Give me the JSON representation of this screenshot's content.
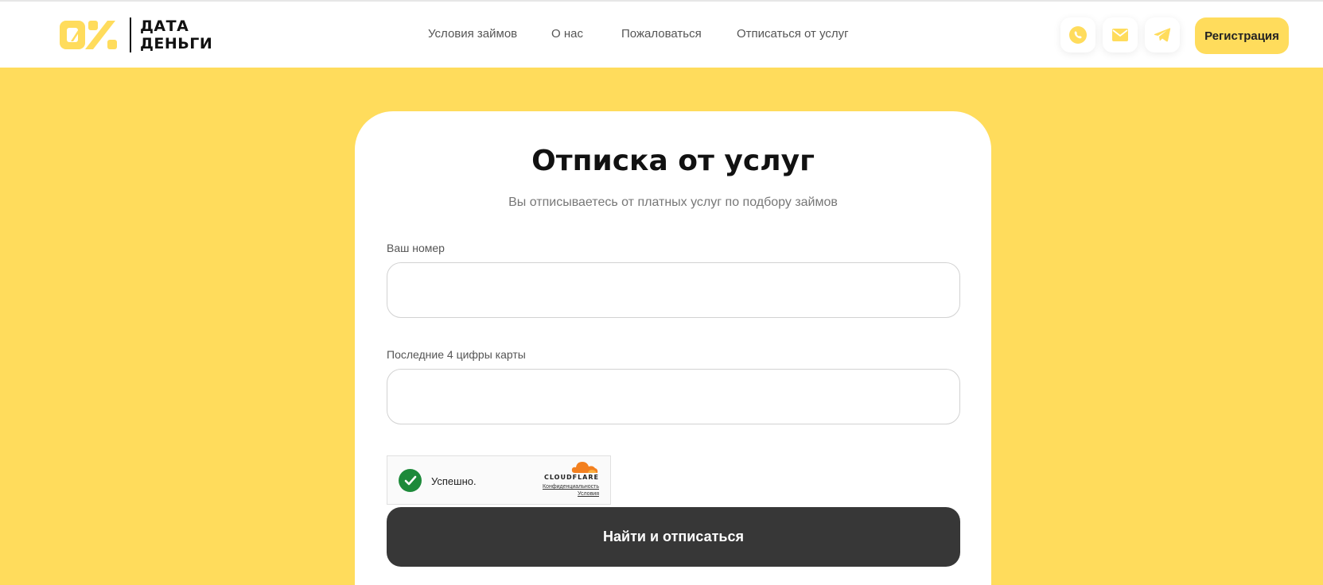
{
  "brand": {
    "line1": "ДАТА",
    "line2": "ДЕНЬГИ",
    "accent": "#ffdc5c"
  },
  "nav": {
    "items": [
      {
        "label": "Условия займов"
      },
      {
        "label": "О нас"
      },
      {
        "label": "Пожаловаться"
      },
      {
        "label": "Отписаться от услуг"
      }
    ]
  },
  "header_actions": {
    "icons": [
      "phone-icon",
      "mail-icon",
      "telegram-icon"
    ],
    "register_label": "Регистрация"
  },
  "form": {
    "title": "Отписка от услуг",
    "subtitle": "Вы отписываетесь от платных услуг по подбору займов",
    "phone_label": "Ваш номер",
    "phone_value": "",
    "card_label": "Последние 4 цифры карты",
    "card_value": "",
    "submit_label": "Найти и отписаться"
  },
  "captcha": {
    "status": "Успешно.",
    "provider": "CLOUDFLARE",
    "privacy": "Конфиденциальность",
    "terms": "Условия",
    "status_color": "#1d8a3a"
  },
  "colors": {
    "background": "#ffdc5c",
    "button_dark": "#373737"
  }
}
